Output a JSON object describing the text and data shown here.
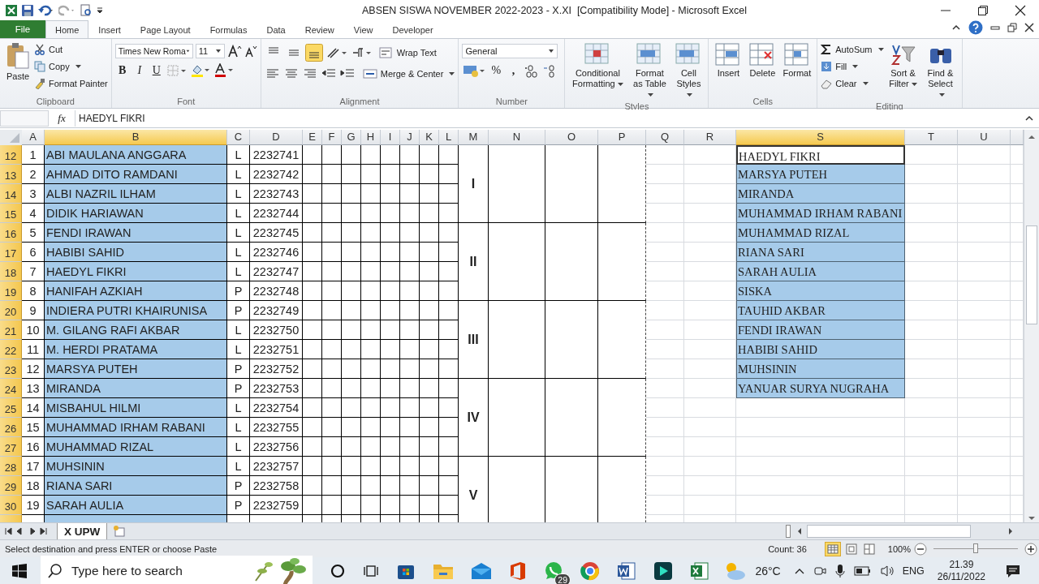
{
  "window": {
    "title": "ABSEN SISWA NOVEMBER 2022-2023 - X.XI  [Compatibility Mode] - Microsoft Excel"
  },
  "ribbon_tabs": [
    {
      "label": "File",
      "selected": false,
      "kind": "file"
    },
    {
      "label": "Home",
      "selected": true,
      "kind": "tab"
    },
    {
      "label": "Insert",
      "selected": false,
      "kind": "tab"
    },
    {
      "label": "Page Layout",
      "selected": false,
      "kind": "tab"
    },
    {
      "label": "Formulas",
      "selected": false,
      "kind": "tab"
    },
    {
      "label": "Data",
      "selected": false,
      "kind": "tab"
    },
    {
      "label": "Review",
      "selected": false,
      "kind": "tab"
    },
    {
      "label": "View",
      "selected": false,
      "kind": "tab"
    },
    {
      "label": "Developer",
      "selected": false,
      "kind": "tab"
    }
  ],
  "clipboard": {
    "label": "Clipboard",
    "paste": "Paste",
    "cut": "Cut",
    "copy": "Copy",
    "format_painter": "Format Painter"
  },
  "font": {
    "label": "Font",
    "font_name": "Times New Roma",
    "font_size": "11",
    "bold": "B",
    "italic": "I",
    "underline": "U"
  },
  "alignment": {
    "label": "Alignment",
    "wrap_text": "Wrap Text",
    "merge_center": "Merge & Center",
    "vertical_align": [
      {
        "selected": false
      },
      {
        "selected": false
      },
      {
        "selected": true
      }
    ]
  },
  "number": {
    "label": "Number",
    "format": "General",
    "percent": "%",
    "comma": ","
  },
  "styles": {
    "label": "Styles",
    "buttons": [
      "Conditional Formatting",
      "Format as Table",
      "Cell Styles"
    ]
  },
  "cells": {
    "label": "Cells",
    "buttons": [
      "Insert",
      "Delete",
      "Format"
    ]
  },
  "editing": {
    "label": "Editing",
    "autosum": "AutoSum",
    "fill": "Fill",
    "clear": "Clear",
    "sort_filter": "Sort & Filter",
    "find_select": "Find & Select"
  },
  "formula_bar": {
    "function_label": "fx",
    "value": "HAEDYL FIKRI"
  },
  "columns": [
    {
      "label": "A",
      "selected": false
    },
    {
      "label": "B",
      "selected": true
    },
    {
      "label": "C",
      "selected": false
    },
    {
      "label": "D",
      "selected": false
    },
    {
      "label": "E",
      "selected": false
    },
    {
      "label": "F",
      "selected": false
    },
    {
      "label": "G",
      "selected": false
    },
    {
      "label": "H",
      "selected": false
    },
    {
      "label": "I",
      "selected": false
    },
    {
      "label": "J",
      "selected": false
    },
    {
      "label": "K",
      "selected": false
    },
    {
      "label": "L",
      "selected": false
    },
    {
      "label": "M",
      "selected": false
    },
    {
      "label": "N",
      "selected": false
    },
    {
      "label": "O",
      "selected": false
    },
    {
      "label": "P",
      "selected": false
    },
    {
      "label": "Q",
      "selected": false
    },
    {
      "label": "R",
      "selected": false
    },
    {
      "label": "S",
      "selected": true
    },
    {
      "label": "T",
      "selected": false
    },
    {
      "label": "U",
      "selected": false
    }
  ],
  "rows": [
    {
      "header": "12",
      "selected": true,
      "no": "1",
      "name": "ABI MAULANA ANGGARA",
      "gender": "L",
      "nis": "2232741"
    },
    {
      "header": "13",
      "selected": true,
      "no": "2",
      "name": "AHMAD DITO RAMDANI",
      "gender": "L",
      "nis": "2232742"
    },
    {
      "header": "14",
      "selected": true,
      "no": "3",
      "name": "ALBI NAZRIL ILHAM",
      "gender": "L",
      "nis": "2232743"
    },
    {
      "header": "15",
      "selected": true,
      "no": "4",
      "name": "DIDIK HARIAWAN",
      "gender": "L",
      "nis": "2232744"
    },
    {
      "header": "16",
      "selected": true,
      "no": "5",
      "name": "FENDI IRAWAN",
      "gender": "L",
      "nis": "2232745"
    },
    {
      "header": "17",
      "selected": true,
      "no": "6",
      "name": "HABIBI SAHID",
      "gender": "L",
      "nis": "2232746"
    },
    {
      "header": "18",
      "selected": true,
      "no": "7",
      "name": "HAEDYL FIKRI",
      "gender": "L",
      "nis": "2232747"
    },
    {
      "header": "19",
      "selected": true,
      "no": "8",
      "name": "HANIFAH AZKIAH",
      "gender": "P",
      "nis": "2232748"
    },
    {
      "header": "20",
      "selected": true,
      "no": "9",
      "name": "INDIERA PUTRI KHAIRUNISA",
      "gender": "P",
      "nis": "2232749"
    },
    {
      "header": "21",
      "selected": true,
      "no": "10",
      "name": "M. GILANG RAFI AKBAR",
      "gender": "L",
      "nis": "2232750"
    },
    {
      "header": "22",
      "selected": true,
      "no": "11",
      "name": "M. HERDI PRATAMA",
      "gender": "L",
      "nis": "2232751"
    },
    {
      "header": "23",
      "selected": true,
      "no": "12",
      "name": "MARSYA PUTEH",
      "gender": "P",
      "nis": "2232752"
    },
    {
      "header": "24",
      "selected": true,
      "no": "13",
      "name": "MIRANDA",
      "gender": "P",
      "nis": "2232753"
    },
    {
      "header": "25",
      "selected": true,
      "no": "14",
      "name": "MISBAHUL HILMI",
      "gender": "L",
      "nis": "2232754"
    },
    {
      "header": "26",
      "selected": true,
      "no": "15",
      "name": "MUHAMMAD IRHAM RABANI",
      "gender": "L",
      "nis": "2232755"
    },
    {
      "header": "27",
      "selected": true,
      "no": "16",
      "name": "MUHAMMAD RIZAL",
      "gender": "L",
      "nis": "2232756"
    },
    {
      "header": "28",
      "selected": true,
      "no": "17",
      "name": "MUHSININ",
      "gender": "L",
      "nis": "2232757"
    },
    {
      "header": "29",
      "selected": true,
      "no": "18",
      "name": "RIANA SARI",
      "gender": "P",
      "nis": "2232758"
    },
    {
      "header": "30",
      "selected": true,
      "no": "19",
      "name": "SARAH AULIA",
      "gender": "P",
      "nis": "2232759"
    }
  ],
  "groups": [
    "I",
    "II",
    "III",
    "IV",
    "V"
  ],
  "side_list": [
    {
      "name": "HAEDYL FIKRI",
      "selected": true
    },
    {
      "name": "MARSYA PUTEH",
      "selected": false
    },
    {
      "name": "MIRANDA",
      "selected": false
    },
    {
      "name": "MUHAMMAD IRHAM RABANI",
      "selected": false
    },
    {
      "name": "MUHAMMAD RIZAL",
      "selected": false
    },
    {
      "name": "RIANA SARI",
      "selected": false
    },
    {
      "name": "SARAH AULIA",
      "selected": false
    },
    {
      "name": "SISKA",
      "selected": false
    },
    {
      "name": "TAUHID AKBAR",
      "selected": false
    },
    {
      "name": "FENDI IRAWAN",
      "selected": false
    },
    {
      "name": "HABIBI SAHID",
      "selected": false
    },
    {
      "name": "MUHSININ",
      "selected": false
    },
    {
      "name": "YANUAR SURYA NUGRAHA",
      "selected": false
    }
  ],
  "sheet_tabs": [
    {
      "label": "X UPW",
      "selected": true
    }
  ],
  "status_bar": {
    "message": "Select destination and press ENTER or choose Paste",
    "count": "Count: 36",
    "zoom": "100%",
    "zoom_slider": {
      "level": 0.5
    }
  },
  "taskbar": {
    "search_placeholder": "Type here to search",
    "whatsapp_badge": "29",
    "temperature": "26°C",
    "language": "ENG",
    "time": "21.39",
    "date": "26/11/2022"
  }
}
